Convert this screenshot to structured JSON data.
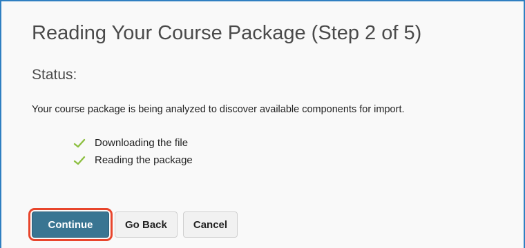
{
  "page": {
    "title": "Reading Your Course Package (Step 2 of 5)",
    "status_heading": "Status:",
    "status_message": "Your course package is being analyzed to discover available components for import."
  },
  "steps": [
    {
      "label": "Downloading the file",
      "icon": "check-icon",
      "state": "complete"
    },
    {
      "label": "Reading the package",
      "icon": "check-icon",
      "state": "complete"
    }
  ],
  "buttons": {
    "continue_label": "Continue",
    "go_back_label": "Go Back",
    "cancel_label": "Cancel"
  },
  "colors": {
    "accent_border": "#2f7fc1",
    "primary_button": "#397592",
    "highlight": "#e8452c",
    "check": "#8cbf3f"
  }
}
